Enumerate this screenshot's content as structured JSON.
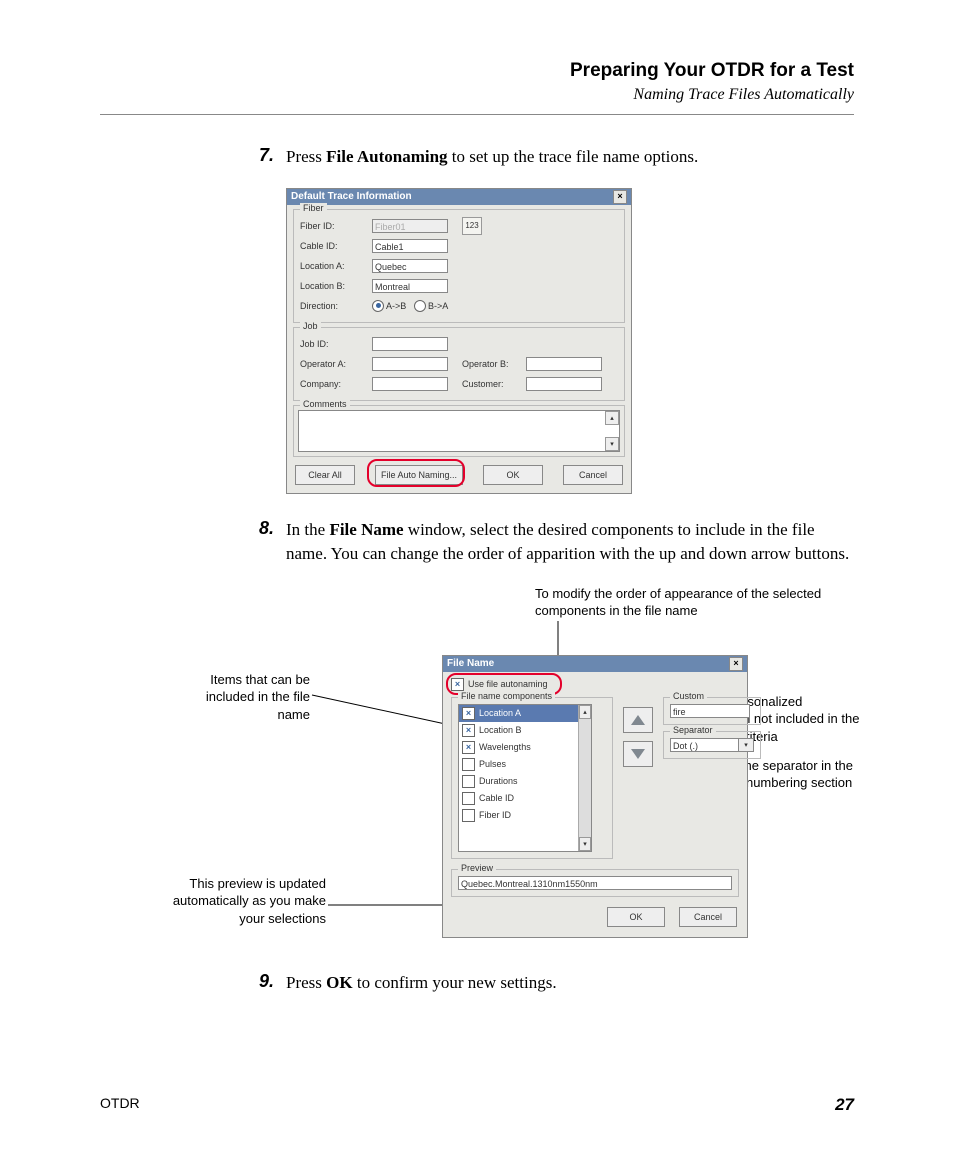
{
  "header": {
    "title": "Preparing Your OTDR for a Test",
    "subtitle": "Naming Trace Files Automatically"
  },
  "steps": {
    "s7num": "7.",
    "s7_pre": "Press ",
    "s7_bold": "File Autonaming",
    "s7_post": " to set up the trace file name options.",
    "s8num": "8.",
    "s8_pre": "In the ",
    "s8_bold": "File Name",
    "s8_post": " window, select the desired components to include in the file name. You can change the order of apparition with the up and down arrow buttons.",
    "s9num": "9.",
    "s9_pre": "Press ",
    "s9_bold": "OK",
    "s9_post": " to confirm your new settings."
  },
  "dlg1": {
    "title": "Default Trace Information",
    "close": "×",
    "groups": {
      "fiber": "Fiber",
      "job": "Job",
      "comments": "Comments"
    },
    "labels": {
      "fiberId": "Fiber ID:",
      "cableId": "Cable ID:",
      "locA": "Location A:",
      "locB": "Location B:",
      "direction": "Direction:",
      "jobId": "Job ID:",
      "opA": "Operator A:",
      "opB": "Operator B:",
      "company": "Company:",
      "customer": "Customer:"
    },
    "values": {
      "fiberId": "Fiber01",
      "cableId": "Cable1",
      "locA": "Quebec",
      "locB": "Montreal",
      "dirAB": "A->B",
      "dirBA": "B->A"
    },
    "buttons": {
      "clear": "Clear All",
      "auton": "File Auto Naming...",
      "ok": "OK",
      "cancel": "Cancel"
    }
  },
  "callouts": {
    "order": "To modify the order of appearance of the selected components in the file name",
    "items": "Items that can be included in the file name",
    "custom": "To add personalized information not included in the filename criteria",
    "sep": "To select the separator in the automatic numbering section",
    "preview": "This preview is updated automatically as you make your selections"
  },
  "dlg2": {
    "title": "File Name",
    "close": "×",
    "useAuton": "Use file autonaming",
    "grpComponents": "File name components",
    "grpCustom": "Custom",
    "grpSep": "Separator",
    "grpPreview": "Preview",
    "list": [
      "Location A",
      "Location B",
      "Wavelengths",
      "Pulses",
      "Durations",
      "Cable ID",
      "Fiber ID"
    ],
    "listChecked": [
      true,
      true,
      true,
      false,
      false,
      false,
      false
    ],
    "customValue": "fire",
    "sepValue": "Dot (.)",
    "previewValue": "Quebec.Montreal.1310nm1550nm",
    "buttons": {
      "ok": "OK",
      "cancel": "Cancel"
    }
  },
  "footer": {
    "product": "OTDR",
    "page": "27"
  }
}
